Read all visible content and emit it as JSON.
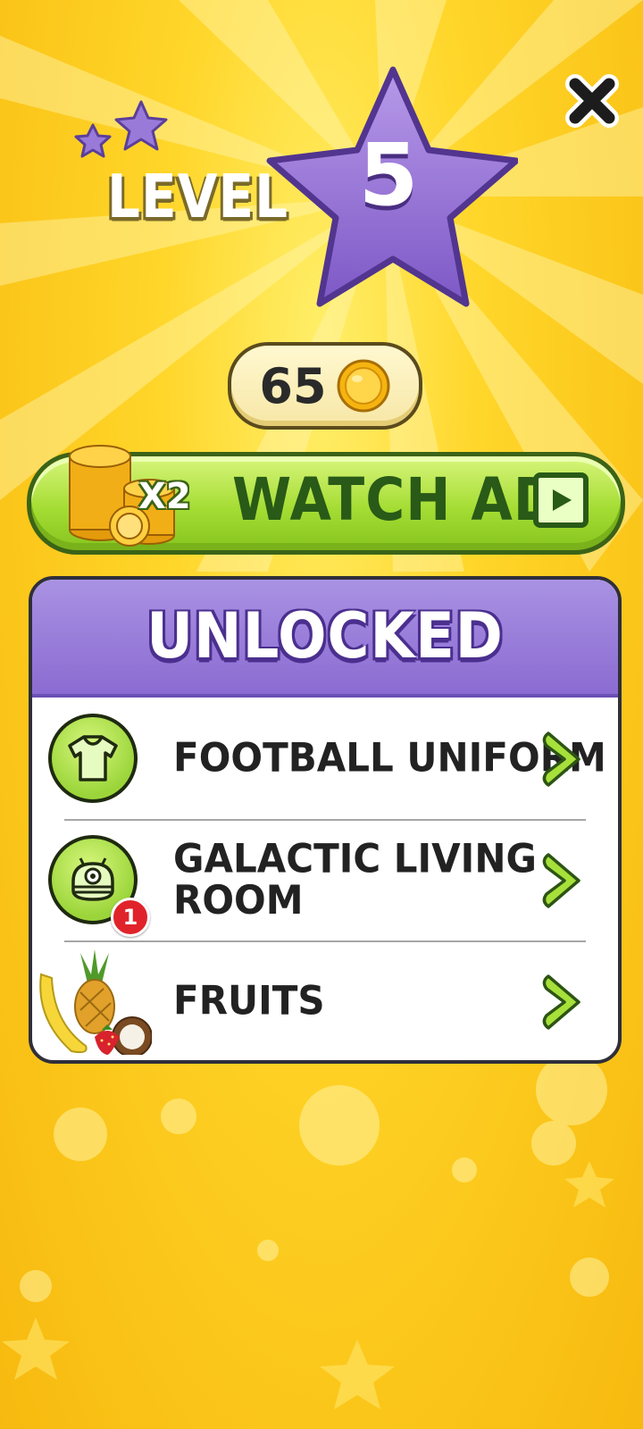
{
  "header": {
    "level_label": "LEVEL",
    "level_number": "5"
  },
  "coins": {
    "count": "65"
  },
  "watch_ad": {
    "multiplier": "X2",
    "label": "WATCH AD"
  },
  "unlocked": {
    "title": "UNLOCKED",
    "items": [
      {
        "label": "FOOTBALL UNIFORM",
        "icon": "tshirt-icon"
      },
      {
        "label_line1": "GALACTIC LIVING",
        "label_line2": "ROOM",
        "icon": "robot-icon",
        "badge": "1"
      },
      {
        "label": "FRUITS",
        "icon": "fruits-icon"
      }
    ]
  },
  "colors": {
    "background": "#ffd62a",
    "accent_purple": "#8b6bd1",
    "button_green": "#a5dd34",
    "text_dark_green": "#295a17"
  }
}
